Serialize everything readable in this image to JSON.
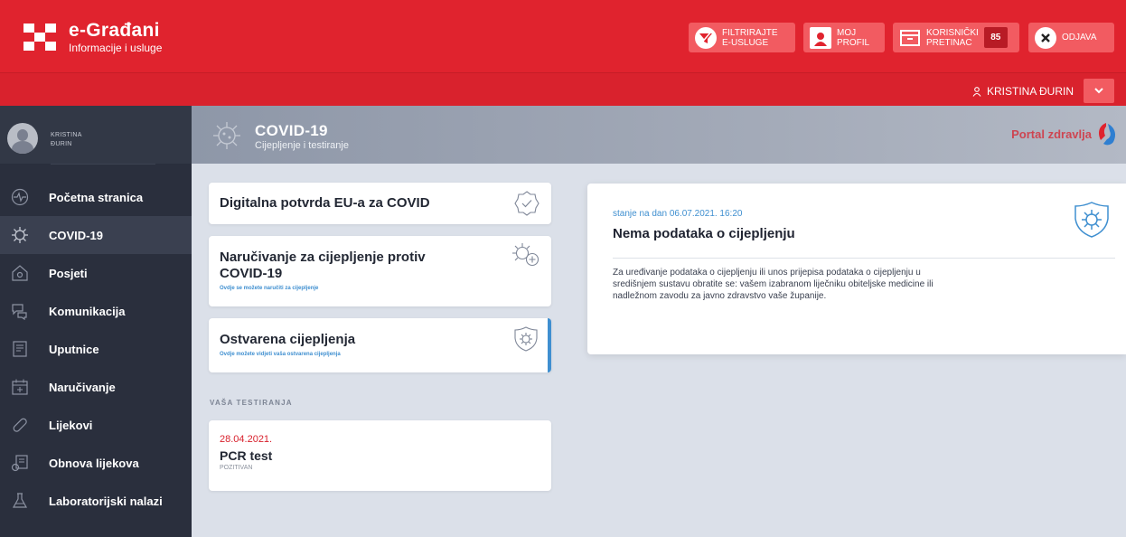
{
  "header": {
    "brand_title": "e-Građani",
    "brand_subtitle": "Informacije i usluge",
    "buttons": {
      "filter": "FILTRIRAJTE\nE-USLUGE",
      "profile": "MOJ\nPROFIL",
      "inbox": "KORISNIČKI\nPRETINAC",
      "inbox_count": "85",
      "logout": "ODJAVA"
    },
    "user_name": "KRISTINA ĐURIN"
  },
  "sidebar": {
    "profile_name_line1": "KRISTINA",
    "profile_name_line2": "ĐURIN",
    "items": [
      {
        "label": "Početna stranica",
        "icon": "heartbeat-icon"
      },
      {
        "label": "COVID-19",
        "icon": "virus-icon",
        "active": true
      },
      {
        "label": "Posjeti",
        "icon": "home-icon"
      },
      {
        "label": "Komunikacija",
        "icon": "chat-icon"
      },
      {
        "label": "Uputnice",
        "icon": "document-icon"
      },
      {
        "label": "Naručivanje",
        "icon": "calendar-icon"
      },
      {
        "label": "Lijekovi",
        "icon": "pill-icon"
      },
      {
        "label": "Obnova lijekova",
        "icon": "prescription-icon"
      },
      {
        "label": "Laboratorijski nalazi",
        "icon": "flask-icon"
      }
    ]
  },
  "page_header": {
    "title": "COVID-19",
    "subtitle": "Cijepljenje i testiranje",
    "portal": "Portal zdravlja"
  },
  "cards": [
    {
      "title": "Digitalna potvrda EU-a za COVID",
      "desc": ""
    },
    {
      "title": "Naručivanje za cijepljenje protiv COVID-19",
      "desc": "Ovdje se možete naručiti za cijepljenje"
    },
    {
      "title": "Ostvarena cijepljenja",
      "desc": "Ovdje možete vidjeti vaša ostvarena cijepljenja"
    }
  ],
  "tests": {
    "section_label": "VAŠA TESTIRANJA",
    "items": [
      {
        "date": "28.04.2021.",
        "name": "PCR test",
        "status": "POZITIVAN"
      }
    ]
  },
  "vaccination_info": {
    "date_label": "stanje na dan 06.07.2021. 16:20",
    "title": "Nema podataka o cijepljenju",
    "text": "Za uređivanje podataka o cijepljenju ili unos prijepisa podataka o cijepljenju u središnjem sustavu obratite se: vašem izabranom liječniku obiteljske medicine ili nadležnom zavodu za javno zdravstvo vaše županije."
  },
  "colors": {
    "brand_red": "#e0232e",
    "sidebar_bg": "#2a2f3d",
    "accent_blue": "#3f8fd0"
  }
}
